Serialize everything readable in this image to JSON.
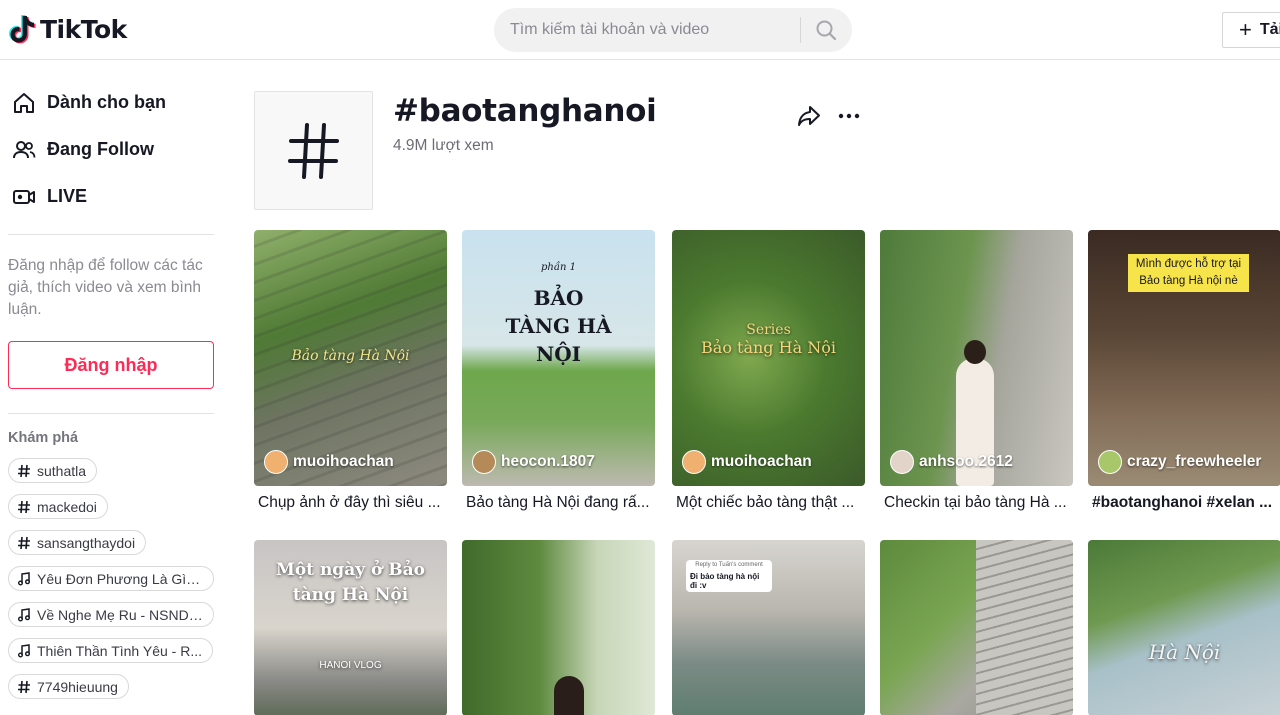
{
  "header": {
    "logo_text": "TikTok",
    "search_placeholder": "Tìm kiếm tài khoản và video",
    "upload_label": "Tải lên"
  },
  "sidebar": {
    "nav": [
      {
        "label": "Dành cho bạn",
        "icon": "home-icon"
      },
      {
        "label": "Đang Follow",
        "icon": "following-icon"
      },
      {
        "label": "LIVE",
        "icon": "live-icon"
      }
    ],
    "login_hint": "Đăng nhập để follow các tác giả, thích video và xem bình luận.",
    "login_button": "Đăng nhập",
    "explore_title": "Khám phá",
    "explore": [
      {
        "type": "hashtag",
        "label": "suthatla"
      },
      {
        "type": "hashtag",
        "label": "mackedoi"
      },
      {
        "type": "hashtag",
        "label": "sansangthaydoi"
      },
      {
        "type": "music",
        "label": "Yêu Đơn Phương Là Gì (..."
      },
      {
        "type": "music",
        "label": "Về Nghe Mẹ Ru - NSND ..."
      },
      {
        "type": "music",
        "label": "Thiên Thần Tình Yêu - R..."
      },
      {
        "type": "hashtag",
        "label": "7749hieuung"
      }
    ]
  },
  "tag": {
    "title": "#baotanghanoi",
    "views": "4.9M lượt xem"
  },
  "videos": [
    {
      "author": "muoihoachan",
      "desc": "Chụp ảnh ở đây thì siêu ...",
      "overlay": "Bảo tàng Hà Nội"
    },
    {
      "author": "heocon.1807",
      "desc": "Bảo tàng Hà Nội đang rấ...",
      "overlay_small": "phần 1",
      "overlay": "BẢO TÀNG HÀ NỘI"
    },
    {
      "author": "muoihoachan",
      "desc": "Một chiếc bảo tàng thật ...",
      "overlay_small": "Series",
      "overlay": "Bảo tàng Hà Nội"
    },
    {
      "author": "anhsoo.2612",
      "desc": "Checkin tại bảo tàng Hà ...",
      "overlay": ""
    },
    {
      "author": "crazy_freewheeler",
      "desc": "#baotanghanoi #xelan ...",
      "overlay": "Mình được hỗ trợ tại Bảo tàng Hà nội nè"
    },
    {
      "overlay": "Một ngày ở Bảo tàng Hà Nội",
      "overlay_small": "HANOI VLOG"
    },
    {
      "overlay": ""
    },
    {
      "overlay_small": "Reply to Tuấn's comment",
      "overlay": "Đi bảo tàng hà nội đi :v"
    },
    {
      "overlay": ""
    },
    {
      "overlay": "Hà Nội"
    }
  ]
}
